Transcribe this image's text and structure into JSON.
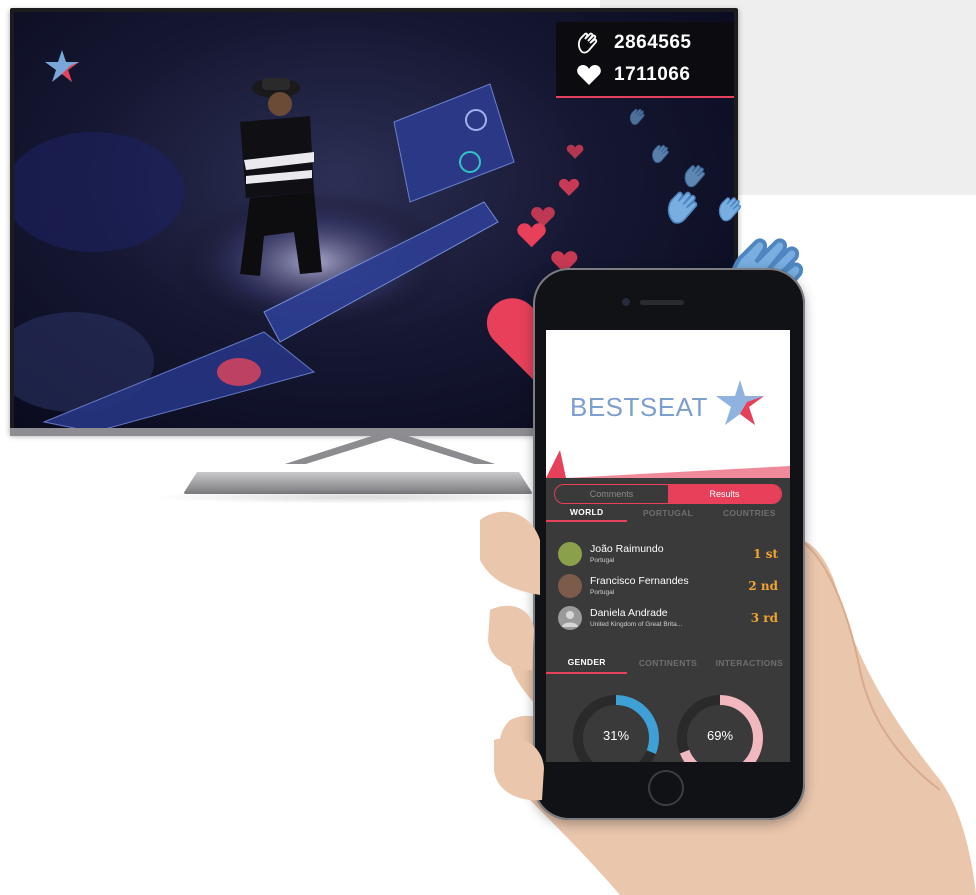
{
  "tv": {
    "stats": {
      "claps": "2864565",
      "likes": "1711066"
    }
  },
  "app": {
    "brand": "BESTSEAT",
    "segments": [
      {
        "label": "Comments",
        "active": false
      },
      {
        "label": "Results",
        "active": true
      }
    ],
    "region_tabs": [
      {
        "label": "WORLD",
        "active": true
      },
      {
        "label": "PORTUGAL",
        "active": false
      },
      {
        "label": "COUNTRIES",
        "active": false
      }
    ],
    "rankings": [
      {
        "name": "João Raimundo",
        "country": "Portugal",
        "place": "1 st"
      },
      {
        "name": "Francisco Fernandes",
        "country": "Portugal",
        "place": "2 nd"
      },
      {
        "name": "Daniela Andrade",
        "country": "United Kingdom of Great Brita...",
        "place": "3 rd"
      }
    ],
    "stat_tabs": [
      {
        "label": "GENDER",
        "active": true
      },
      {
        "label": "CONTINENTS",
        "active": false
      },
      {
        "label": "INTERACTIONS",
        "active": false
      }
    ],
    "gender": [
      {
        "label": "31%",
        "value": 0.31,
        "color": "#3fa0d6"
      },
      {
        "label": "69%",
        "value": 0.69,
        "color": "#f2b8c0"
      }
    ]
  },
  "colors": {
    "accent": "#e8405a",
    "clap_blue": "#78aee0",
    "gold": "#f2a531"
  },
  "icons": [
    "star-logo-icon",
    "clap-icon",
    "heart-icon"
  ]
}
